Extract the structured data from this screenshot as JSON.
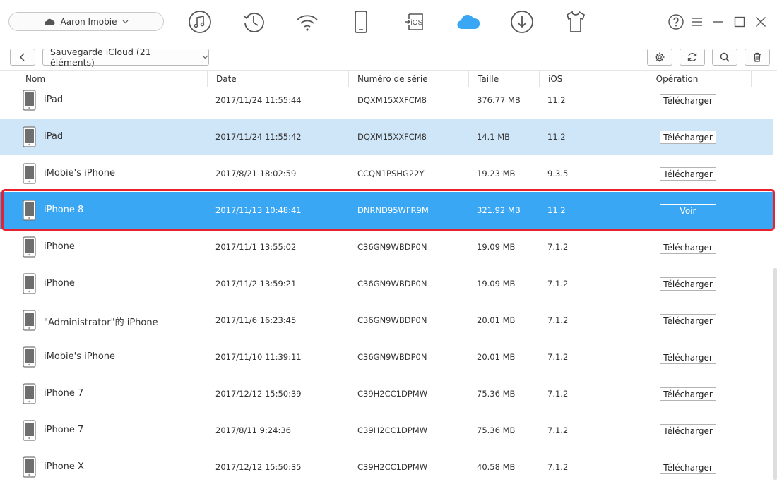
{
  "device": {
    "name": "Aaron Imobie"
  },
  "nav": [
    {
      "icon": "music-icon"
    },
    {
      "icon": "history-icon"
    },
    {
      "icon": "wifi-icon"
    },
    {
      "icon": "phone-icon"
    },
    {
      "icon": "ios-transfer-icon",
      "label": "iOS"
    },
    {
      "icon": "icloud-icon",
      "active": true
    },
    {
      "icon": "download-icon"
    },
    {
      "icon": "tshirt-icon"
    }
  ],
  "toolbar": {
    "backup_label": "Sauvegarde iCloud (21 éléments)"
  },
  "columns": {
    "name": "Nom",
    "date": "Date",
    "serial": "Numéro de série",
    "size": "Taille",
    "ios": "iOS",
    "operation": "Opération"
  },
  "rows": [
    {
      "name": "iPad",
      "date": "2017/11/24 11:55:44",
      "serial": "DQXM15XXFCM8",
      "size": "376.77 MB",
      "ios": "11.2",
      "action": "Télécharger"
    },
    {
      "name": "iPad",
      "date": "2017/11/24 11:55:42",
      "serial": "DQXM15XXFCM8",
      "size": "14.1 MB",
      "ios": "11.2",
      "action": "Télécharger"
    },
    {
      "name": "iMobie's iPhone",
      "date": "2017/8/21 18:02:59",
      "serial": "CCQN1PSHG22Y",
      "size": "19.23 MB",
      "ios": "9.3.5",
      "action": "Télécharger"
    },
    {
      "name": "iPhone 8",
      "date": "2017/11/13 10:48:41",
      "serial": "DNRND95WFR9M",
      "size": "321.92 MB",
      "ios": "11.2",
      "action": "Voir"
    },
    {
      "name": "iPhone",
      "date": "2017/11/1 13:55:02",
      "serial": "C36GN9WBDP0N",
      "size": "19.09 MB",
      "ios": "7.1.2",
      "action": "Télécharger"
    },
    {
      "name": "iPhone",
      "date": "2017/11/2 13:59:21",
      "serial": "C36GN9WBDP0N",
      "size": "19.09 MB",
      "ios": "7.1.2",
      "action": "Télécharger"
    },
    {
      "name": "\"Administrator\"的 iPhone",
      "date": "2017/11/6 16:23:45",
      "serial": "C36GN9WBDP0N",
      "size": "20.01 MB",
      "ios": "7.1.2",
      "action": "Télécharger"
    },
    {
      "name": "iMobie's iPhone",
      "date": "2017/11/10 11:39:11",
      "serial": "C36GN9WBDP0N",
      "size": "20.01 MB",
      "ios": "7.1.2",
      "action": "Télécharger"
    },
    {
      "name": "iPhone 7",
      "date": "2017/12/12 15:50:39",
      "serial": "C39H2CC1DPMW",
      "size": "75.36 MB",
      "ios": "7.1.2",
      "action": "Télécharger"
    },
    {
      "name": "iPhone 7",
      "date": "2017/8/11 9:24:36",
      "serial": "C39H2CC1DPMW",
      "size": "75.36 MB",
      "ios": "7.1.2",
      "action": "Télécharger"
    },
    {
      "name": "iPhone X",
      "date": "2017/12/12 15:50:35",
      "serial": "C39H2CC1DPMW",
      "size": "40.58 MB",
      "ios": "7.1.2",
      "action": "Télécharger"
    }
  ],
  "colors": {
    "accent": "#3aa7f5",
    "row_soft": "#cfe6f8",
    "highlight_frame": "#e8212d",
    "icon_gray": "#555555"
  }
}
